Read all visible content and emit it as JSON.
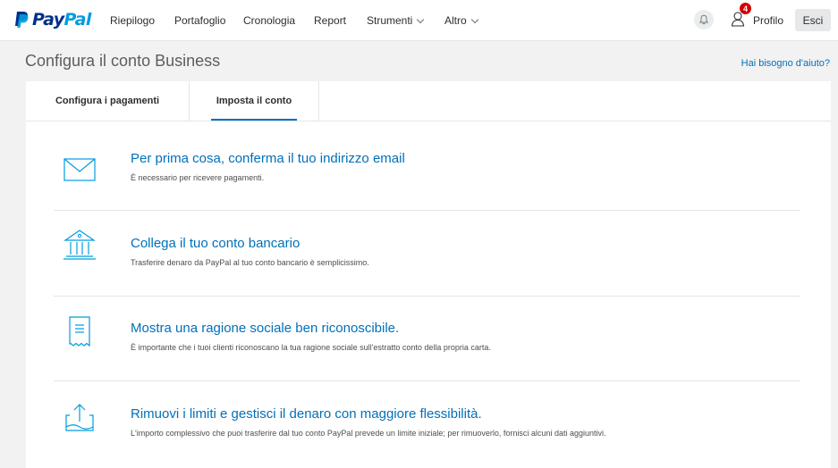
{
  "brand": {
    "name_pay": "Pay",
    "name_pal": "Pal"
  },
  "nav": {
    "items": [
      {
        "label": "Riepilogo"
      },
      {
        "label": "Portafoglio"
      },
      {
        "label": "Cronologia"
      },
      {
        "label": "Report"
      },
      {
        "label": "Strumenti"
      },
      {
        "label": "Altro"
      }
    ],
    "notification_count": "4",
    "profile_label": "Profilo",
    "logout_label": "Esci"
  },
  "page": {
    "title": "Configura il conto Business",
    "help_link": "Hai bisogno d'aiuto?"
  },
  "tabs": [
    {
      "label": "Configura i pagamenti",
      "active": false
    },
    {
      "label": "Imposta il conto",
      "active": true
    }
  ],
  "steps": [
    {
      "icon": "envelope-icon",
      "title": "Per prima cosa, conferma il tuo indirizzo email",
      "description": "È necessario per ricevere pagamenti."
    },
    {
      "icon": "bank-icon",
      "title": "Collega il tuo conto bancario",
      "description": "Trasferire denaro da PayPal al tuo conto bancario è semplicissimo."
    },
    {
      "icon": "receipt-icon",
      "title": "Mostra una ragione sociale ben riconoscibile.",
      "description": "È importante che i tuoi clienti riconoscano la tua ragione sociale sull'estratto conto della propria carta."
    },
    {
      "icon": "upload-tray-icon",
      "title": "Rimuovi i limiti e gestisci il denaro con maggiore flessibilità.",
      "description": "L'importo complessivo che puoi trasferire dal tuo conto PayPal prevede un limite iniziale; per rimuoverlo, fornisci alcuni dati aggiuntivi."
    }
  ],
  "colors": {
    "accent": "#0070ba",
    "brand_dark": "#003087",
    "brand_light": "#009cde",
    "badge": "#d20000",
    "background": "#f2f2f2"
  }
}
